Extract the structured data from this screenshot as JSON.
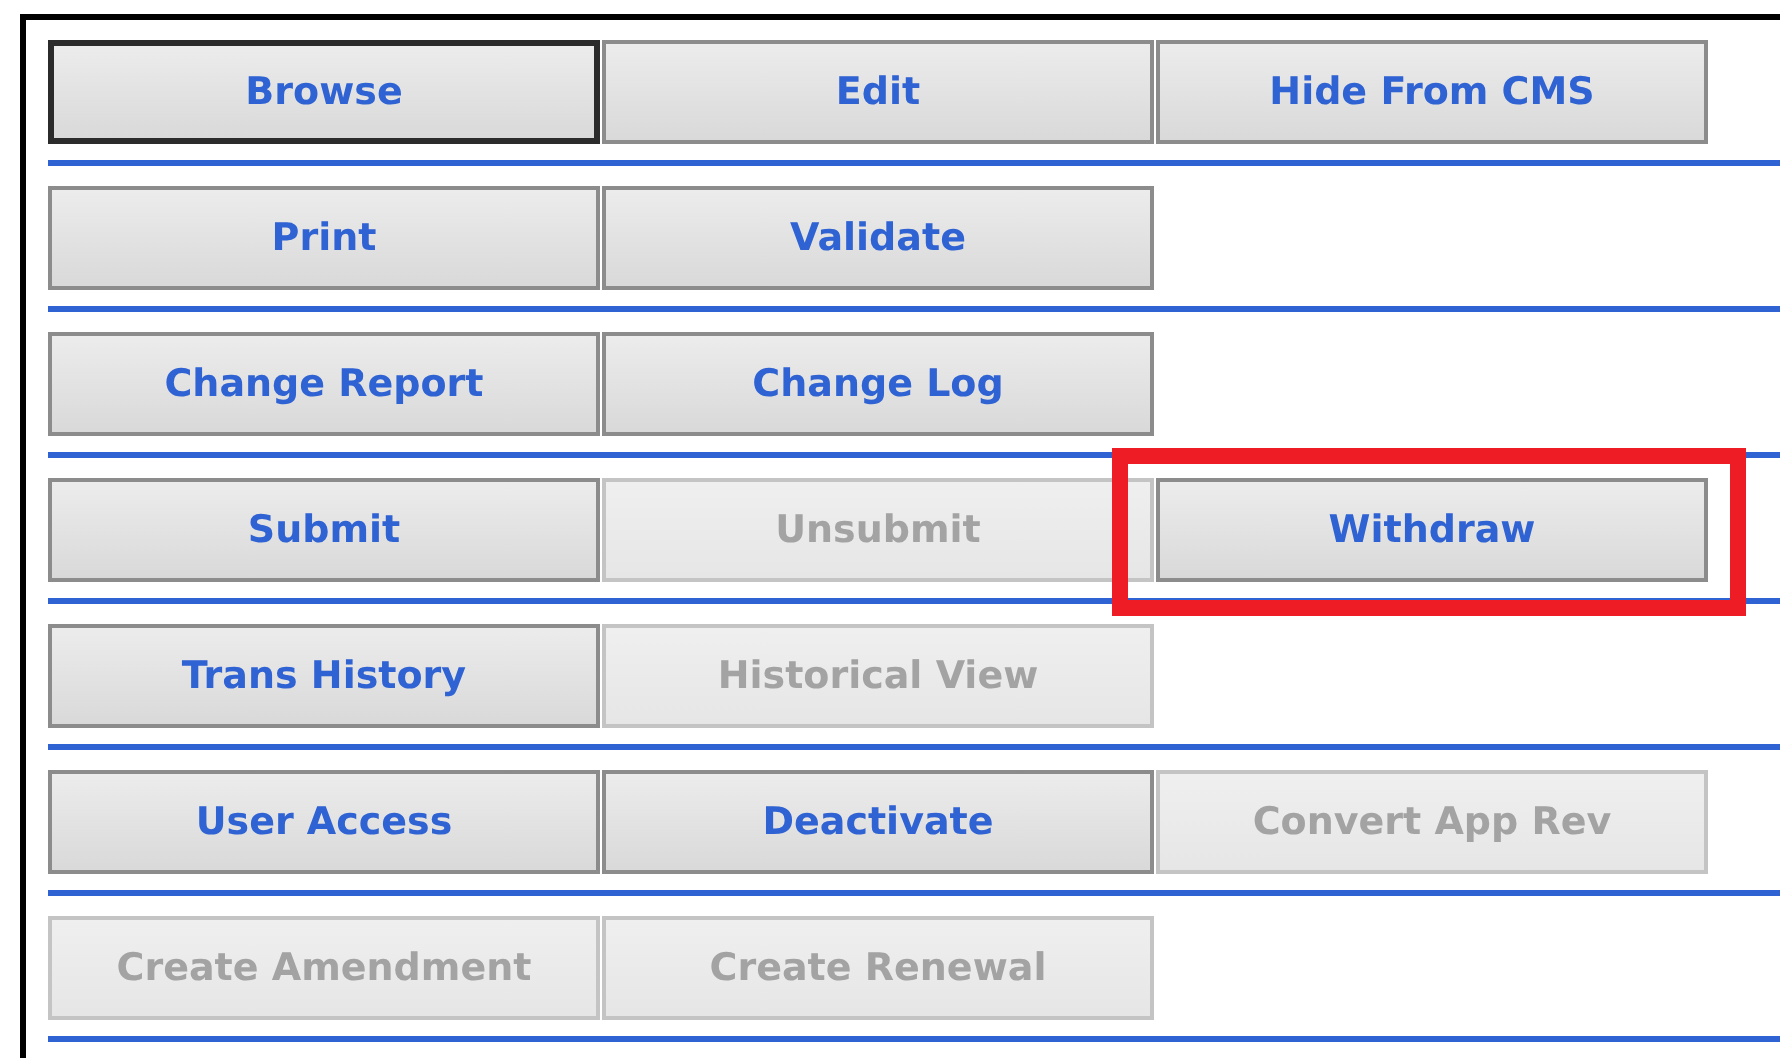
{
  "rows": [
    [
      {
        "label": "Browse",
        "disabled": false,
        "focused": true,
        "highlighted": false
      },
      {
        "label": "Edit",
        "disabled": false,
        "focused": false,
        "highlighted": false
      },
      {
        "label": "Hide From CMS",
        "disabled": false,
        "focused": false,
        "highlighted": false
      }
    ],
    [
      {
        "label": "Print",
        "disabled": false,
        "focused": false,
        "highlighted": false
      },
      {
        "label": "Validate",
        "disabled": false,
        "focused": false,
        "highlighted": false
      }
    ],
    [
      {
        "label": "Change Report",
        "disabled": false,
        "focused": false,
        "highlighted": false
      },
      {
        "label": "Change Log",
        "disabled": false,
        "focused": false,
        "highlighted": false
      }
    ],
    [
      {
        "label": "Submit",
        "disabled": false,
        "focused": false,
        "highlighted": false
      },
      {
        "label": "Unsubmit",
        "disabled": true,
        "focused": false,
        "highlighted": false
      },
      {
        "label": "Withdraw",
        "disabled": false,
        "focused": false,
        "highlighted": true
      }
    ],
    [
      {
        "label": "Trans History",
        "disabled": false,
        "focused": false,
        "highlighted": false
      },
      {
        "label": "Historical View",
        "disabled": true,
        "focused": false,
        "highlighted": false
      }
    ],
    [
      {
        "label": "User Access",
        "disabled": false,
        "focused": false,
        "highlighted": false
      },
      {
        "label": "Deactivate",
        "disabled": false,
        "focused": false,
        "highlighted": false
      },
      {
        "label": "Convert App Rev",
        "disabled": true,
        "focused": false,
        "highlighted": false
      }
    ],
    [
      {
        "label": "Create Amendment",
        "disabled": true,
        "focused": false,
        "highlighted": false
      },
      {
        "label": "Create Renewal",
        "disabled": true,
        "focused": false,
        "highlighted": false
      }
    ]
  ]
}
